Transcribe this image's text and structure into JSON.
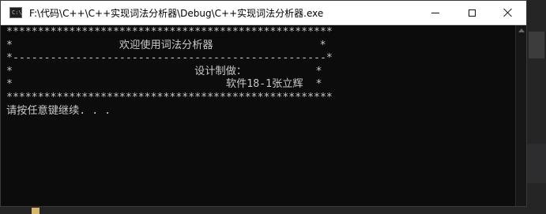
{
  "window": {
    "title": "F:\\代码\\C++\\C++实现词法分析器\\Debug\\C++实现词法分析器.exe",
    "icon": "console-app-icon"
  },
  "console": {
    "lines": [
      "****************************************************",
      "*                 欢迎使用词法分析器                 *",
      "*--------------------------------------------------*",
      "*                             设计制做：           *",
      "*                                  软件18-1张立辉  *",
      "****************************************************",
      "请按任意键继续. . ."
    ]
  }
}
